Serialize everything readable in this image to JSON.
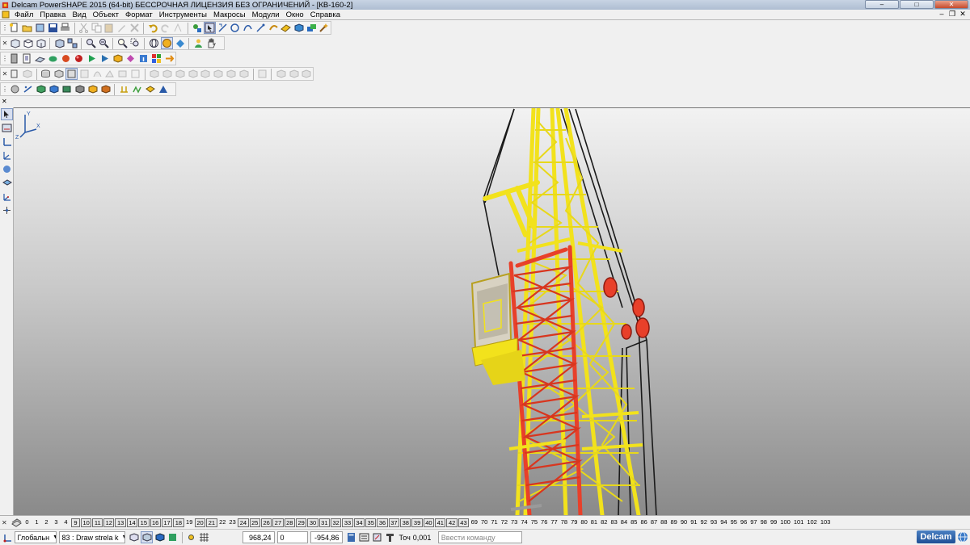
{
  "window": {
    "title": "Delcam PowerSHAPE 2015 (64-bit) БЕССРОЧНАЯ ЛИЦЕНЗИЯ БЕЗ ОГРАНИЧЕНИЙ - [КВ-160-2]",
    "controls": [
      "–",
      "□",
      "✕"
    ]
  },
  "menu": {
    "items": [
      "Файл",
      "Правка",
      "Вид",
      "Объект",
      "Формат",
      "Инструменты",
      "Макросы",
      "Модули",
      "Окно",
      "Справка"
    ],
    "mdi_controls": [
      "–",
      "❐",
      "✕"
    ]
  },
  "toolbars": {
    "row1_icons": [
      "new-file",
      "open-folder",
      "open-model",
      "save",
      "print",
      "undo",
      "redo",
      "cut",
      "copy",
      "paste",
      "delete",
      "blank",
      "select-pointer",
      "circle-tool",
      "curve-tool",
      "point-tool",
      "wireframe",
      "surface",
      "solid",
      "assembly",
      "magic-tool"
    ],
    "row2_icons": [
      "view-front",
      "view-top",
      "view-iso",
      "cube-view",
      "zoom-in",
      "zoom-out",
      "zoom-all",
      "zoom-window",
      "globe-view",
      "shading",
      "light",
      "person-view",
      "hand-pan"
    ],
    "row3_icons": [
      "layer",
      "document",
      "sphere",
      "color",
      "material",
      "arrow-shape",
      "cube-shape",
      "diamond",
      "colors"
    ],
    "row4_icons": [
      "sheet",
      "cube-grey",
      "drum",
      "box",
      "bevel",
      "fillet",
      "blend",
      "sweep",
      "extrude",
      "revolve",
      "offset",
      "shell",
      "split",
      "rotate",
      "move",
      "mirror"
    ],
    "row5_icons": [
      "sphere-grey",
      "curve-xy",
      "solid-a",
      "solid-b",
      "solid-c",
      "solid-d",
      "solid-e",
      "solid-f",
      "solid-g",
      "solid-h",
      "solid-i",
      "blue-arrow"
    ]
  },
  "left_toolbar": {
    "icons": [
      "pointer-icon",
      "dimension-icon",
      "axis-icon",
      "workplane-icon",
      "sphere-icon",
      "tool-icon",
      "coordinate-icon",
      "snap-icon"
    ]
  },
  "viewport": {
    "triad_labels": [
      "Y",
      "X",
      "Z"
    ]
  },
  "layers": {
    "items": [
      {
        "n": "0",
        "b": false
      },
      {
        "n": "1",
        "b": false
      },
      {
        "n": "2",
        "b": false
      },
      {
        "n": "3",
        "b": false
      },
      {
        "n": "4",
        "b": false
      },
      {
        "n": "9",
        "b": true
      },
      {
        "n": "10",
        "b": true
      },
      {
        "n": "11",
        "b": true
      },
      {
        "n": "12",
        "b": true
      },
      {
        "n": "13",
        "b": true
      },
      {
        "n": "14",
        "b": true
      },
      {
        "n": "15",
        "b": true
      },
      {
        "n": "16",
        "b": true
      },
      {
        "n": "17",
        "b": true
      },
      {
        "n": "18",
        "b": true
      },
      {
        "n": "19",
        "b": false
      },
      {
        "n": "20",
        "b": true
      },
      {
        "n": "21",
        "b": true
      },
      {
        "n": "22",
        "b": false
      },
      {
        "n": "23",
        "b": false
      },
      {
        "n": "24",
        "b": true
      },
      {
        "n": "25",
        "b": true
      },
      {
        "n": "26",
        "b": true
      },
      {
        "n": "27",
        "b": true
      },
      {
        "n": "28",
        "b": true
      },
      {
        "n": "29",
        "b": true
      },
      {
        "n": "30",
        "b": true
      },
      {
        "n": "31",
        "b": true
      },
      {
        "n": "32",
        "b": true
      },
      {
        "n": "33",
        "b": true
      },
      {
        "n": "34",
        "b": true
      },
      {
        "n": "35",
        "b": true
      },
      {
        "n": "36",
        "b": true
      },
      {
        "n": "37",
        "b": true
      },
      {
        "n": "38",
        "b": true
      },
      {
        "n": "39",
        "b": true
      },
      {
        "n": "40",
        "b": true
      },
      {
        "n": "41",
        "b": true
      },
      {
        "n": "42",
        "b": true
      },
      {
        "n": "43",
        "b": true
      },
      {
        "n": "69",
        "b": false
      },
      {
        "n": "70",
        "b": false
      },
      {
        "n": "71",
        "b": false
      },
      {
        "n": "72",
        "b": false
      },
      {
        "n": "73",
        "b": false
      },
      {
        "n": "74",
        "b": false
      },
      {
        "n": "75",
        "b": false
      },
      {
        "n": "76",
        "b": false
      },
      {
        "n": "77",
        "b": false
      },
      {
        "n": "78",
        "b": false
      },
      {
        "n": "79",
        "b": false
      },
      {
        "n": "80",
        "b": false
      },
      {
        "n": "81",
        "b": false
      },
      {
        "n": "82",
        "b": false
      },
      {
        "n": "83",
        "b": false
      },
      {
        "n": "84",
        "b": false
      },
      {
        "n": "85",
        "b": false
      },
      {
        "n": "86",
        "b": false
      },
      {
        "n": "87",
        "b": false
      },
      {
        "n": "88",
        "b": false
      },
      {
        "n": "89",
        "b": false
      },
      {
        "n": "90",
        "b": false
      },
      {
        "n": "91",
        "b": false
      },
      {
        "n": "92",
        "b": false
      },
      {
        "n": "93",
        "b": false
      },
      {
        "n": "94",
        "b": false
      },
      {
        "n": "95",
        "b": false
      },
      {
        "n": "96",
        "b": false
      },
      {
        "n": "97",
        "b": false
      },
      {
        "n": "98",
        "b": false
      },
      {
        "n": "99",
        "b": false
      },
      {
        "n": "100",
        "b": false
      },
      {
        "n": "101",
        "b": false
      },
      {
        "n": "102",
        "b": false
      },
      {
        "n": "103",
        "b": false
      }
    ]
  },
  "status": {
    "workplane": "Глобальн",
    "level_num": "83",
    "level_name": ": Draw strela k",
    "x": "968,24",
    "y": "0",
    "z": "-954,86",
    "tol_label": "Точ",
    "tol_value": "0,001",
    "command_placeholder": "Ввести команду",
    "brand": "Delcam"
  },
  "colors": {
    "crane_yellow": "#f2e21c",
    "crane_red": "#e8402a",
    "cable": "#1a1a1a"
  }
}
